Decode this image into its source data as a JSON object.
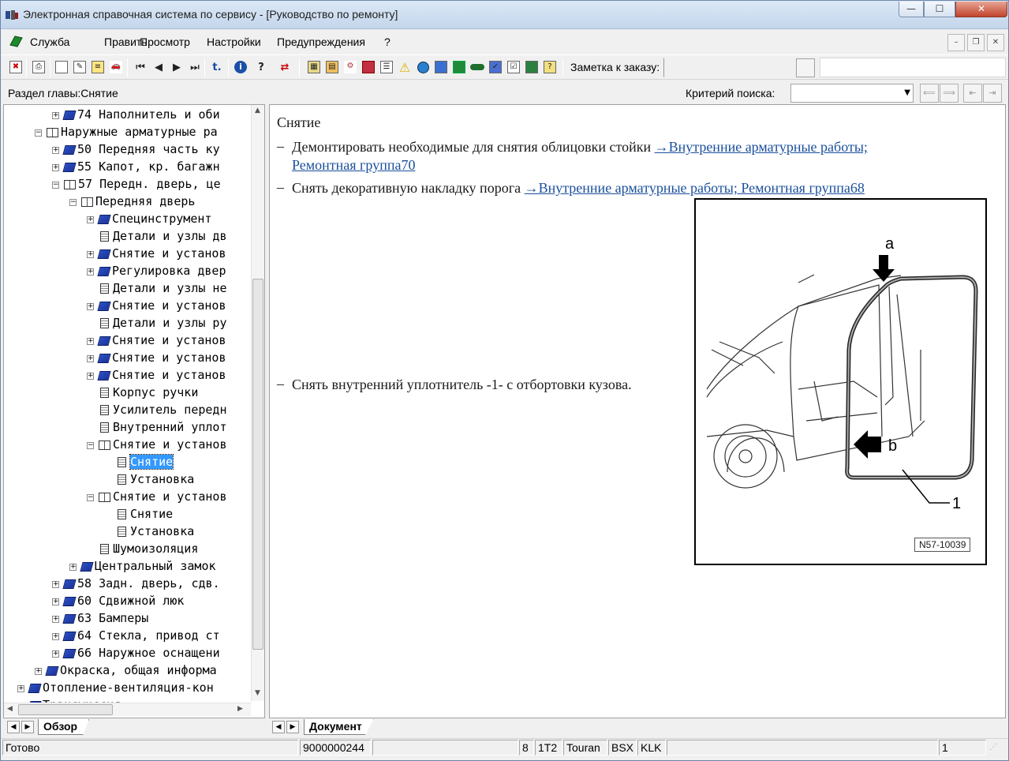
{
  "window": {
    "title": "Электронная справочная система по сервису - [Руководство по ремонту]",
    "min_symbol": "—",
    "max_symbol": "☐",
    "close_symbol": "✕"
  },
  "menu": {
    "items": [
      "Служба",
      "Править",
      "Просмотр",
      "Настройки",
      "Предупреждения",
      "?"
    ]
  },
  "toolbar": {
    "order_label": "Заметка к заказу:",
    "order_value": ""
  },
  "section": {
    "label": "Раздел главы:Снятие",
    "search_label": "Критерий  поиска:",
    "search_value": ""
  },
  "tree": {
    "items": [
      {
        "text": "74 Наполнитель и оби"
      },
      {
        "text": "Наружные арматурные ра"
      },
      {
        "text": "50 Передняя часть ку"
      },
      {
        "text": "55 Капот, кр. багажн"
      },
      {
        "text": "57 Передн. дверь, це"
      },
      {
        "text": "Передняя дверь"
      },
      {
        "text": "Специнструмент"
      },
      {
        "text": "Детали и узлы дв"
      },
      {
        "text": "Снятие и установ"
      },
      {
        "text": "Регулировка двер"
      },
      {
        "text": "Детали и узлы не"
      },
      {
        "text": "Снятие и установ"
      },
      {
        "text": "Детали и узлы ру"
      },
      {
        "text": "Снятие и установ"
      },
      {
        "text": "Снятие и установ"
      },
      {
        "text": "Снятие и установ"
      },
      {
        "text": "Корпус ручки"
      },
      {
        "text": "Усилитель передн"
      },
      {
        "text": "Внутренний уплот"
      },
      {
        "text": "Снятие и установ"
      },
      {
        "text": "Снятие"
      },
      {
        "text": "Установка"
      },
      {
        "text": "Снятие и установ"
      },
      {
        "text": "Снятие"
      },
      {
        "text": "Установка"
      },
      {
        "text": "Шумоизоляция"
      },
      {
        "text": "Центральный замок"
      },
      {
        "text": "58 Задн. дверь, сдв."
      },
      {
        "text": "60 Сдвижной люк"
      },
      {
        "text": "63 Бамперы"
      },
      {
        "text": "64 Стекла, привод ст"
      },
      {
        "text": "66 Наружное оснащени"
      },
      {
        "text": "Окраска, общая информа"
      },
      {
        "text": "Отопление-вентиляция-кон"
      },
      {
        "text": "Трансмиссия"
      }
    ],
    "selected": "Снятие",
    "tab_label": "Обзор"
  },
  "document": {
    "title": "Снятие",
    "tab_label": "Документ",
    "steps": [
      {
        "dash": "–",
        "text": "Демонтировать необходимые для снятия облицовки стойки ",
        "link": "→Внутренние арматурные работы; Ремонтная группа70"
      },
      {
        "dash": "–",
        "text": "Снять декоративную накладку порога ",
        "link": "→Внутренние арматурные работы; Ремонтная группа68"
      },
      {
        "dash": "–",
        "text": "Снять внутренний уплотнитель -1- с отбортовки кузова.",
        "link": ""
      }
    ],
    "figure": {
      "label_a": "a",
      "label_b": "b",
      "label_1": "1",
      "code": "N57-10039"
    }
  },
  "status": {
    "state": "Готово",
    "order_no": "9000000244",
    "field_8": "8",
    "model_code": "1T2",
    "model": "Touran",
    "engine": "BSX",
    "gearbox": "KLK",
    "page": "1"
  }
}
